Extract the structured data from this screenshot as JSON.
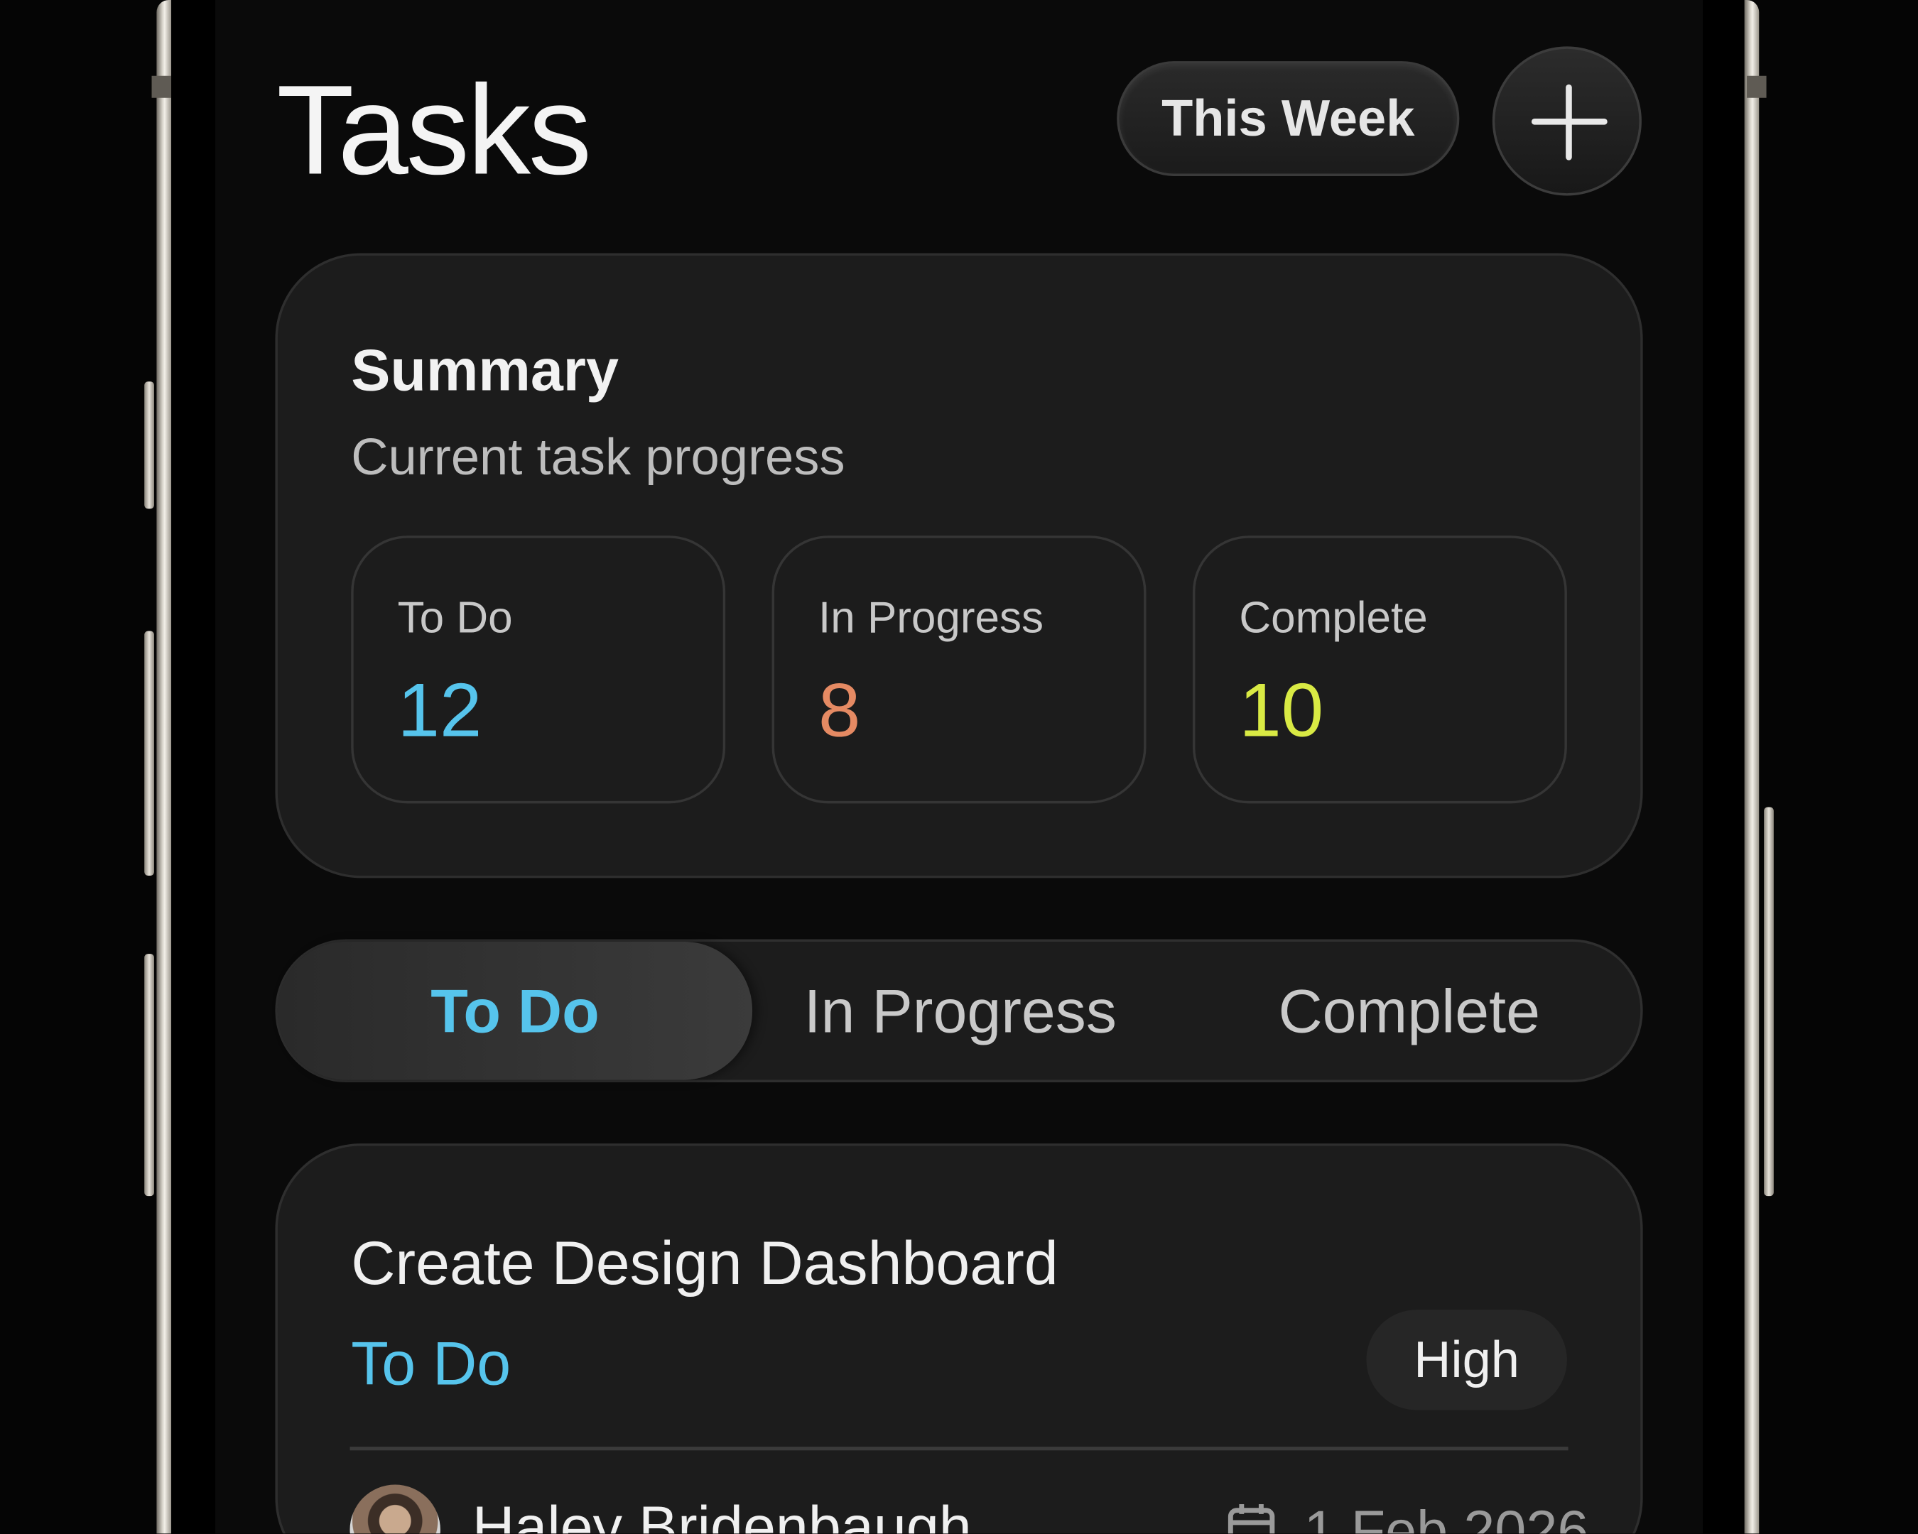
{
  "header": {
    "title": "Tasks",
    "period_label": "This Week",
    "add_icon": "plus-icon"
  },
  "summary": {
    "title": "Summary",
    "subtitle": "Current task progress",
    "stats": [
      {
        "label": "To Do",
        "value": "12",
        "color": "#56c4ec"
      },
      {
        "label": "In Progress",
        "value": "8",
        "color": "#e58a63"
      },
      {
        "label": "Complete",
        "value": "10",
        "color": "#d9ea44"
      }
    ]
  },
  "tabs": [
    {
      "label": "To Do",
      "active": true,
      "color": "#56c4ec"
    },
    {
      "label": "In Progress",
      "active": false,
      "color": "#c9c9c9"
    },
    {
      "label": "Complete",
      "active": false,
      "color": "#c9c9c9"
    }
  ],
  "task": {
    "title": "Create Design Dashboard",
    "status": "To Do",
    "priority": "High",
    "assignee": "Haley Bridenbaugh",
    "due_date": "1 Feb 2026",
    "due_icon": "calendar-icon"
  },
  "colors": {
    "background": "#0a0a0a",
    "card": "#1c1c1c",
    "accent_todo": "#56c4ec",
    "accent_progress": "#e58a63",
    "accent_complete": "#d9ea44"
  }
}
